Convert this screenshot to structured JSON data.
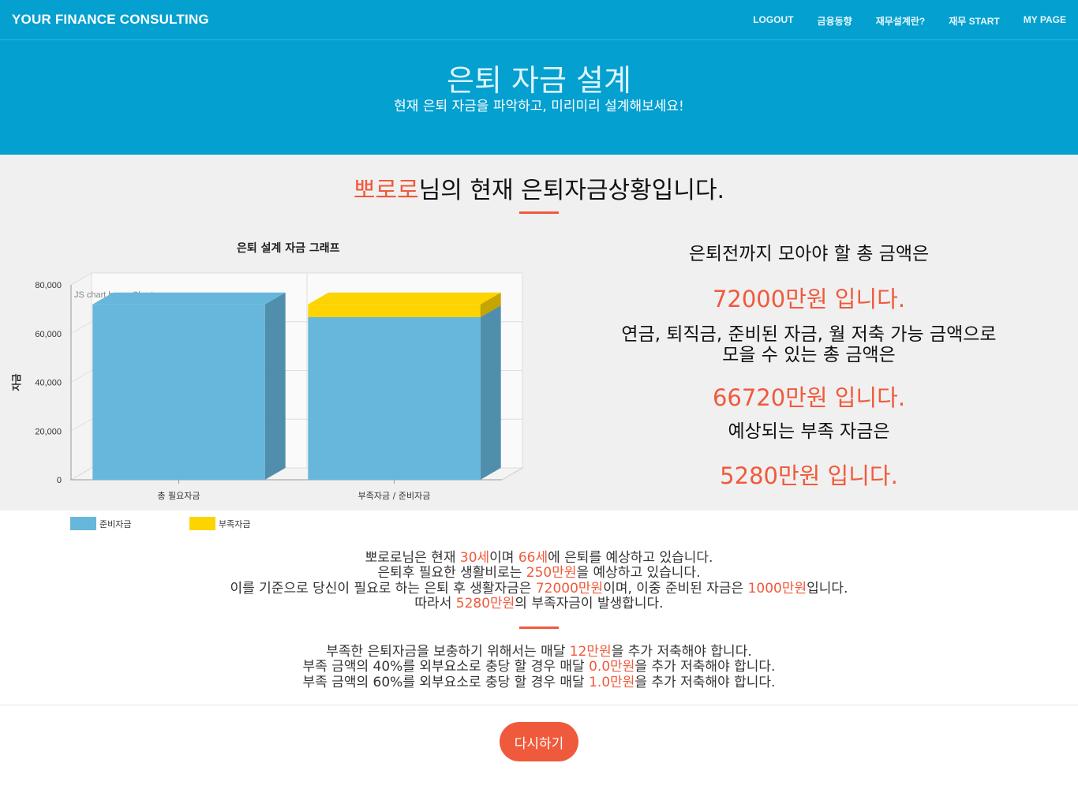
{
  "navbar": {
    "brand": "YOUR FINANCE CONSULTING",
    "links": [
      "LOGOUT",
      "금융동향",
      "재무설계란?",
      "재무 START",
      "MY PAGE"
    ]
  },
  "hero": {
    "title": "은퇴 자금 설계",
    "subtitle": "현재 은퇴 자금을 파악하고, 미리미리 설계해보세요!"
  },
  "summary": {
    "name": "뽀로로",
    "heading_suffix": "님의 현재 은퇴자금상황입니다.",
    "total_needed_label": "은퇴전까지 모아야 할 총 금액은",
    "total_needed": "72000만원 입니다.",
    "collectable_label_1": "연금, 퇴직금, 준비된 자금, 월 저축 가능 금액으로",
    "collectable_label_2": "모을 수 있는 총 금액은",
    "collectable": "66720만원 입니다.",
    "shortage_label": "예상되는 부족 자금은",
    "shortage": "5280만원 입니다."
  },
  "chart_data": {
    "type": "bar",
    "title": "은퇴 설계 자금 그래프",
    "ylabel": "자금",
    "watermark": "JS chart by amCharts",
    "categories": [
      "총 필요자금",
      "부족자금 / 준비자금"
    ],
    "ylim": [
      0,
      80000
    ],
    "yticks": [
      "0",
      "20,000",
      "40,000",
      "60,000",
      "80,000"
    ],
    "stacked": true,
    "legend_position": "bottom-left",
    "series": [
      {
        "name": "준비자금",
        "values": [
          72000,
          66720
        ],
        "color": "#67b7dc"
      },
      {
        "name": "부족자금",
        "values": [
          0,
          5280
        ],
        "color": "#fdd400"
      }
    ]
  },
  "details": {
    "l1": {
      "a": "뽀로로님은 현재 ",
      "age": "30세",
      "b": "이며 ",
      "retire": "66세",
      "c": "에 은퇴를 예상하고 있습니다."
    },
    "l2": {
      "a": "은퇴후 필요한 생활비로는 ",
      "living": "250만원",
      "b": "을 예상하고 있습니다."
    },
    "l3": {
      "a": "이를 기준으로 당신이 필요로 하는 은퇴 후 생활자금은 ",
      "total": "72000만원",
      "b": "이며, 이중 준비된 자금은 ",
      "prepared": "1000만원",
      "c": "입니다."
    },
    "l4": {
      "a": "따라서 ",
      "shortage": "5280만원",
      "b": "의 부족자금이 발생합니다."
    },
    "s1": {
      "a": "부족한 은퇴자금을 보충하기 위해서는 매달 ",
      "v": "12만원",
      "b": "을 추가 저축해야 합니다."
    },
    "s2": {
      "a": "부족 금액의 40%를 외부요소로 충당 할 경우 매달 ",
      "v": "0.0만원",
      "b": "을 추가 저축해야 합니다."
    },
    "s3": {
      "a": "부족 금액의 60%를 외부요소로 충당 할 경우 매달 ",
      "v": "1.0만원",
      "b": "을 추가 저축해야 합니다."
    }
  },
  "retry_button": "다시하기"
}
